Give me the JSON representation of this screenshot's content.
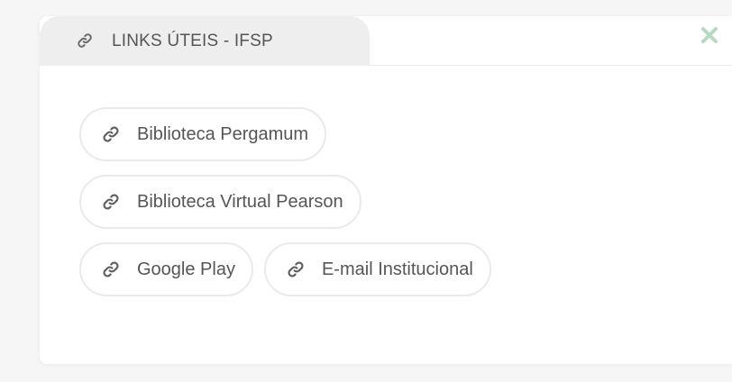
{
  "widget": {
    "tab_title": "LINKS ÚTEIS - IFSP",
    "tab_icon": "link-icon",
    "close_icon": "close-icon",
    "colors": {
      "tab_background": "#eeeeee",
      "close_icon": "#b9d8c2",
      "text": "#555555",
      "chip_border": "#eaeaea"
    }
  },
  "links": [
    {
      "label": "Biblioteca Pergamum",
      "icon": "link-icon"
    },
    {
      "label": "Biblioteca Virtual Pearson",
      "icon": "link-icon"
    },
    {
      "label": "Google Play",
      "icon": "link-icon"
    },
    {
      "label": "E-mail Institucional",
      "icon": "link-icon"
    }
  ]
}
